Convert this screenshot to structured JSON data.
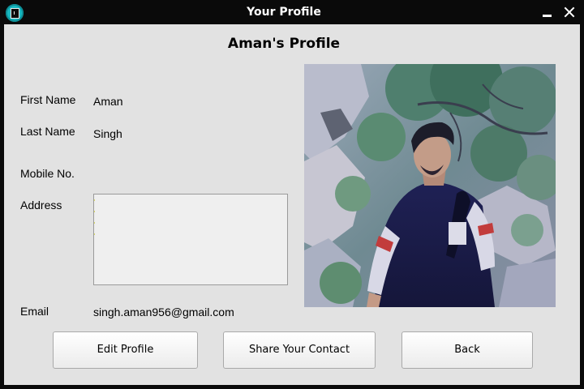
{
  "window": {
    "title": "Your Profile"
  },
  "profile": {
    "heading": "Aman's Profile",
    "fields": {
      "first_name": {
        "label": "First Name",
        "value": "Aman"
      },
      "last_name": {
        "label": "Last Name",
        "value": "Singh"
      },
      "mobile": {
        "label": "Mobile No.",
        "value": ""
      },
      "address": {
        "label": "Address",
        "value": ""
      },
      "email": {
        "label": "Email",
        "value": "singh.aman956@gmail.com"
      }
    }
  },
  "buttons": {
    "edit": "Edit Profile",
    "share": "Share Your Contact",
    "back": "Back"
  },
  "colors": {
    "titlebar": "#0a0a0a",
    "panel": "#e2e2e2",
    "app_icon": "#19b9c2"
  }
}
